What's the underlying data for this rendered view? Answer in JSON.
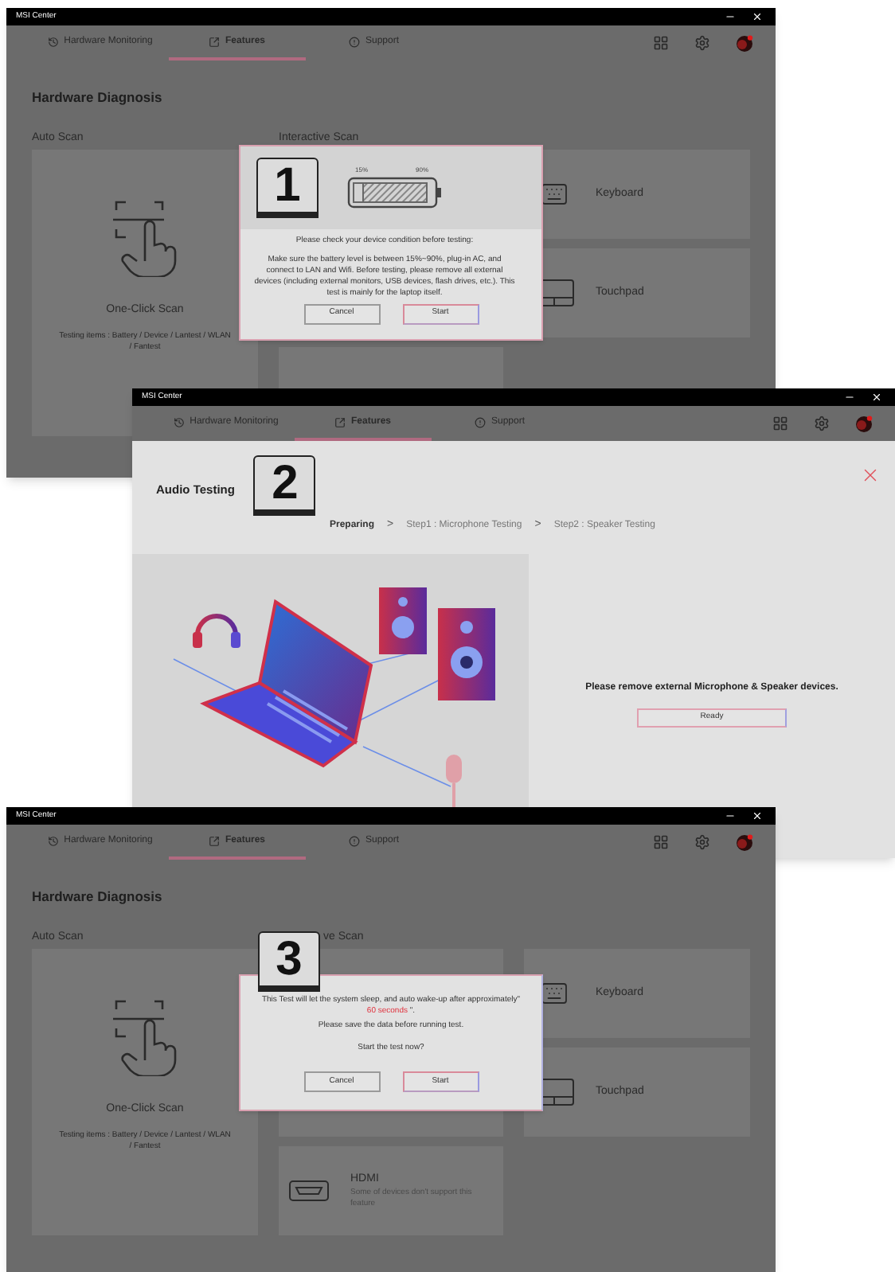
{
  "windows": [
    {
      "kind": "diagnosis",
      "title": "MSI Center",
      "tabs": [
        {
          "label": "Hardware Monitoring",
          "selected": false
        },
        {
          "label": "Features",
          "selected": true
        },
        {
          "label": "Support",
          "selected": false
        }
      ],
      "heading": "Hardware Diagnosis",
      "auto_label": "Auto Scan",
      "interactive_label": "Interactive Scan",
      "one_click": {
        "title": "One-Click Scan",
        "note": "Testing items : Battery / Device / Lantest / WLAN / Fantest"
      },
      "items": [
        {
          "kind": "keyboard",
          "title": "Keyboard"
        },
        {
          "kind": "touchpad",
          "title": "Touchpad"
        }
      ],
      "dialog": {
        "kind": "battery",
        "number": "1",
        "low": "15%",
        "high": "90%",
        "heading": "Please check your device condition before testing:",
        "body": "Make sure the battery level is between 15%~90%, plug-in AC, and connect to LAN and Wifi. Before testing, please remove all external devices (including external monitors, USB devices, flash drives, etc.). This test is mainly for the laptop itself.",
        "buttons": [
          "Cancel",
          "Start"
        ]
      }
    },
    {
      "kind": "audio",
      "title": "MSI Center",
      "tabs": [
        {
          "label": "Hardware Monitoring",
          "selected": false
        },
        {
          "label": "Features",
          "selected": true
        },
        {
          "label": "Support",
          "selected": false
        }
      ],
      "heading": "Audio Testing",
      "number": "2",
      "steps": [
        {
          "label": "Preparing",
          "selected": true
        },
        {
          "prefix": ">",
          "label": "Step1 : Microphone Testing",
          "selected": false
        },
        {
          "prefix": ">",
          "label": "Step2 : Speaker Testing",
          "selected": false
        }
      ],
      "message": "Please remove external Microphone & Speaker devices.",
      "button": "Ready"
    },
    {
      "kind": "diagnosis",
      "title": "MSI Center",
      "tabs": [
        {
          "label": "Hardware Monitoring",
          "selected": false
        },
        {
          "label": "Features",
          "selected": true
        },
        {
          "label": "Support",
          "selected": false
        }
      ],
      "heading": "Hardware Diagnosis",
      "auto_label": "Auto Scan",
      "interactive_label": "ve Scan",
      "one_click": {
        "title": "One-Click Scan",
        "note": "Testing items : Battery / Device / Lantest / WLAN / Fantest"
      },
      "items": [
        {
          "kind": "keyboard",
          "title": "Keyboard"
        },
        {
          "kind": "touchpad",
          "title": "Touchpad"
        },
        {
          "kind": "hdmi",
          "title": "HDMI",
          "note": "Some of devices don't support this feature"
        }
      ],
      "dialog": {
        "kind": "sleep",
        "number": "3",
        "text_before": "This Test will let the system sleep, and auto wake-up after approximately\"",
        "duration": "60 seconds",
        "text_after": "\".",
        "save_note": "Please save the data before running test.",
        "question": "Start the test now?",
        "buttons": [
          "Cancel",
          "Start"
        ]
      }
    }
  ]
}
